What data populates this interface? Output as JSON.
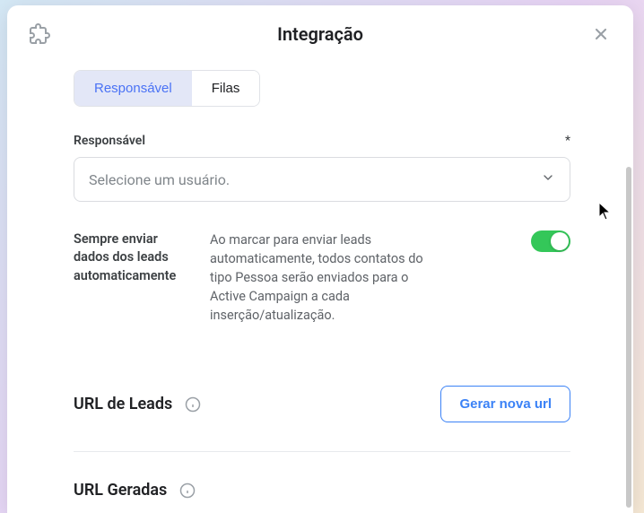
{
  "header": {
    "title": "Integração"
  },
  "tabs": {
    "responsible": "Responsável",
    "queues": "Filas"
  },
  "responsible": {
    "label": "Responsável",
    "required": "*",
    "placeholder": "Selecione um usuário."
  },
  "auto_send": {
    "label": "Sempre enviar dados dos leads automaticamente",
    "desc": "Ao marcar para enviar leads automaticamente, todos contatos do tipo Pessoa serão enviados para o Active Campaign a cada inserção/atualização.",
    "enabled": true
  },
  "leads_url": {
    "title": "URL de Leads",
    "button": "Gerar nova url"
  },
  "generated_url": {
    "title": "URL Geradas"
  }
}
